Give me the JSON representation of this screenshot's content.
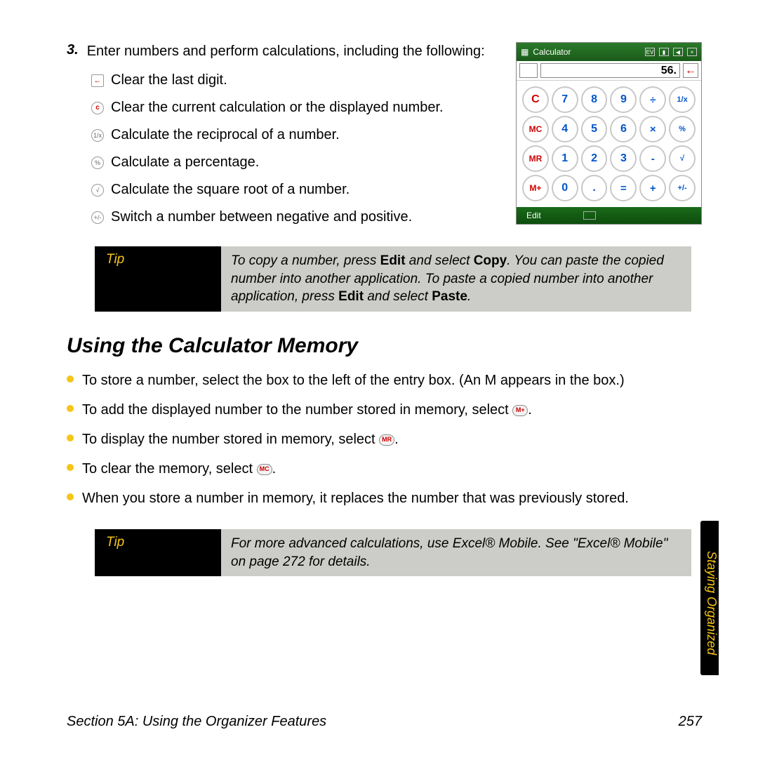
{
  "step": {
    "num": "3.",
    "text": "Enter numbers and perform calculations, including the following:"
  },
  "subitems": [
    {
      "icon": "←",
      "iconClass": "icon-sq",
      "text": "Clear the last digit."
    },
    {
      "icon": "c",
      "iconClass": "c",
      "text": "Clear the current calculation or the displayed number."
    },
    {
      "icon": "1/x",
      "iconClass": "",
      "text": "Calculate the reciprocal of a number."
    },
    {
      "icon": "%",
      "iconClass": "",
      "text": "Calculate a percentage."
    },
    {
      "icon": "√",
      "iconClass": "",
      "text": "Calculate the square root of a number."
    },
    {
      "icon": "+/-",
      "iconClass": "",
      "text": "Switch a number between negative and positive."
    }
  ],
  "calc": {
    "title": "Calculator",
    "display": "56.",
    "back": "←",
    "edit": "Edit",
    "keys": [
      {
        "l": "C",
        "c": "c"
      },
      {
        "l": "7",
        "c": "num"
      },
      {
        "l": "8",
        "c": "num"
      },
      {
        "l": "9",
        "c": "num"
      },
      {
        "l": "÷",
        "c": "op"
      },
      {
        "l": "1/x",
        "c": "fn"
      },
      {
        "l": "MC",
        "c": "mem"
      },
      {
        "l": "4",
        "c": "num"
      },
      {
        "l": "5",
        "c": "num"
      },
      {
        "l": "6",
        "c": "num"
      },
      {
        "l": "×",
        "c": "op"
      },
      {
        "l": "%",
        "c": "fn"
      },
      {
        "l": "MR",
        "c": "mem"
      },
      {
        "l": "1",
        "c": "num"
      },
      {
        "l": "2",
        "c": "num"
      },
      {
        "l": "3",
        "c": "num"
      },
      {
        "l": "-",
        "c": "op"
      },
      {
        "l": "√",
        "c": "fn"
      },
      {
        "l": "M+",
        "c": "mem"
      },
      {
        "l": "0",
        "c": "num"
      },
      {
        "l": ".",
        "c": "num"
      },
      {
        "l": "=",
        "c": "op"
      },
      {
        "l": "+",
        "c": "op"
      },
      {
        "l": "+/-",
        "c": "fn"
      }
    ]
  },
  "tip1": {
    "label": "Tip",
    "pre": "To copy a number, press ",
    "b1": "Edit",
    "mid1": " and select ",
    "b2": "Copy",
    "mid2": ". You can paste the copied number into another application. To paste a copied number into another application, press ",
    "b3": "Edit",
    "mid3": " and select ",
    "b4": "Paste",
    "post": "."
  },
  "heading": "Using the Calculator Memory",
  "bullets": {
    "b0": "To store a number, select the box to the left of the entry box. (An M appears in the box.)",
    "b1a": "To add the displayed number to the number stored in memory, select ",
    "b1icon": "M+",
    "b1b": ".",
    "b2a": "To display the number stored in memory, select ",
    "b2icon": "MR",
    "b2b": ".",
    "b3a": "To clear the memory, select ",
    "b3icon": "MC",
    "b3b": ".",
    "b4": "When you store a number in memory, it replaces the number that was previously stored."
  },
  "tip2": {
    "label": "Tip",
    "text": "For more advanced calculations, use Excel® Mobile. See \"Excel® Mobile\" on page 272 for details."
  },
  "sideTab": "Staying Organized",
  "footer": {
    "left": "Section 5A: Using the Organizer Features",
    "right": "257"
  }
}
